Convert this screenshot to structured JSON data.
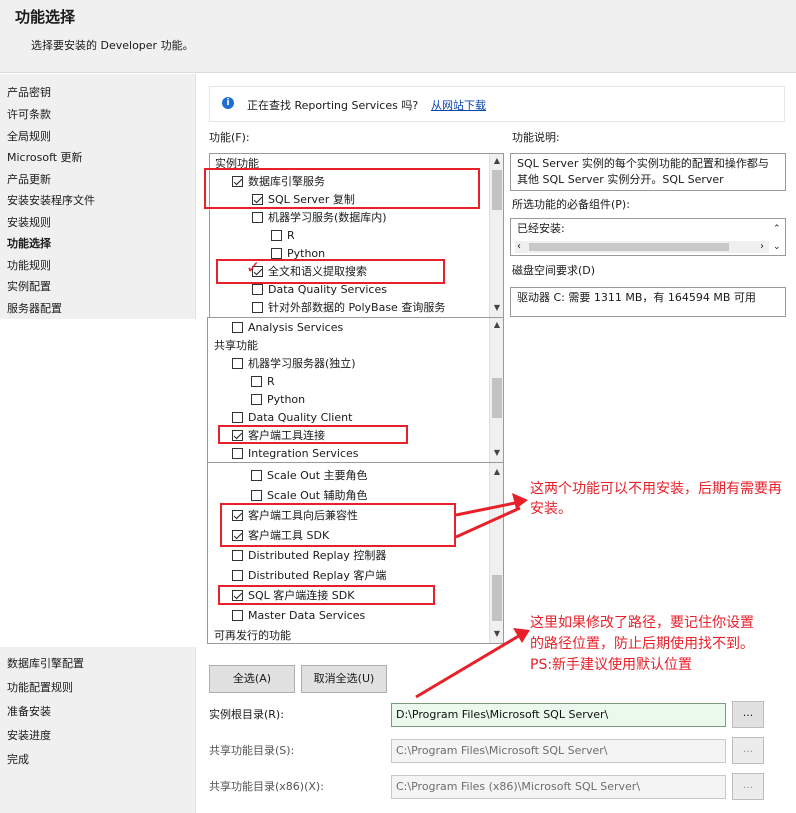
{
  "header": {
    "title": "功能选择",
    "subtitle": "选择要安装的 Developer 功能。"
  },
  "nav_top": [
    {
      "label": "产品密钥",
      "selected": false
    },
    {
      "label": "许可条款",
      "selected": false
    },
    {
      "label": "全局规则",
      "selected": false
    },
    {
      "label": "Microsoft 更新",
      "selected": false
    },
    {
      "label": "产品更新",
      "selected": false
    },
    {
      "label": "安装安装程序文件",
      "selected": false
    },
    {
      "label": "安装规则",
      "selected": false
    },
    {
      "label": "功能选择",
      "selected": true
    },
    {
      "label": "功能规则",
      "selected": false
    },
    {
      "label": "实例配置",
      "selected": false
    },
    {
      "label": "服务器配置",
      "selected": false
    }
  ],
  "nav_bottom": [
    {
      "label": "数据库引擎配置"
    },
    {
      "label": "功能配置规则"
    },
    {
      "label": "准备安装"
    },
    {
      "label": "安装进度"
    },
    {
      "label": "完成"
    }
  ],
  "info": {
    "text": "正在查找 Reporting Services 吗?",
    "link": "从网站下载"
  },
  "features_label": "功能(F):",
  "description_label": "功能说明:",
  "description_text": "SQL Server 实例的每个实例功能的配置和操作都与其他 SQL Server 实例分开。SQL Server",
  "prereq_label": "所选功能的必备组件(P):",
  "prereq_text": "已经安装:",
  "disk_label": "磁盘空间要求(D)",
  "disk_text": "驱动器 C: 需要 1311 MB，有 164594 MB 可用",
  "tree1": [
    {
      "label": "实例功能",
      "type": "group",
      "indent": 0
    },
    {
      "label": "数据库引擎服务",
      "checked": true,
      "indent": 1
    },
    {
      "label": "SQL Server 复制",
      "checked": true,
      "indent": 2
    },
    {
      "label": "机器学习服务(数据库内)",
      "checked": false,
      "indent": 2
    },
    {
      "label": "R",
      "checked": false,
      "indent": 3
    },
    {
      "label": "Python",
      "checked": false,
      "indent": 3
    },
    {
      "label": "全文和语义提取搜索",
      "checked": true,
      "indent": 2
    },
    {
      "label": "Data Quality Services",
      "checked": false,
      "indent": 2
    },
    {
      "label": "针对外部数据的 PolyBase 查询服务",
      "checked": false,
      "indent": 2
    }
  ],
  "tree2": [
    {
      "label": "Analysis Services",
      "checked": false,
      "indent": 1
    },
    {
      "label": "共享功能",
      "type": "group",
      "indent": 0
    },
    {
      "label": "机器学习服务器(独立)",
      "checked": false,
      "indent": 1
    },
    {
      "label": "R",
      "checked": false,
      "indent": 2
    },
    {
      "label": "Python",
      "checked": false,
      "indent": 2
    },
    {
      "label": "Data Quality Client",
      "checked": false,
      "indent": 1
    },
    {
      "label": "客户端工具连接",
      "checked": true,
      "indent": 1
    },
    {
      "label": "Integration Services",
      "checked": false,
      "indent": 1
    }
  ],
  "tree3": [
    {
      "label": "Scale Out 主要角色",
      "checked": false,
      "indent": 2
    },
    {
      "label": "Scale Out 辅助角色",
      "checked": false,
      "indent": 2
    },
    {
      "label": "客户端工具向后兼容性",
      "checked": true,
      "indent": 1
    },
    {
      "label": "客户端工具 SDK",
      "checked": true,
      "indent": 1
    },
    {
      "label": "Distributed Replay 控制器",
      "checked": false,
      "indent": 1
    },
    {
      "label": "Distributed Replay 客户端",
      "checked": false,
      "indent": 1
    },
    {
      "label": "SQL 客户端连接 SDK",
      "checked": true,
      "indent": 1
    },
    {
      "label": "Master Data Services",
      "checked": false,
      "indent": 1
    },
    {
      "label": "可再发行的功能",
      "type": "group",
      "indent": 0
    }
  ],
  "buttons": {
    "select_all": "全选(A)",
    "deselect_all": "取消全选(U)",
    "browse": "..."
  },
  "paths": [
    {
      "label": "实例根目录(R):",
      "value": "D:\\Program Files\\Microsoft SQL Server\\",
      "enabled": true
    },
    {
      "label": "共享功能目录(S):",
      "value": "C:\\Program Files\\Microsoft SQL Server\\",
      "enabled": false
    },
    {
      "label": "共享功能目录(x86)(X):",
      "value": "C:\\Program Files (x86)\\Microsoft SQL Server\\",
      "enabled": false
    }
  ],
  "annotations": {
    "note1": "这两个功能可以不用安装，后期有需要再安装。",
    "note2_line1": "这里如果修改了路径，要记住你设置",
    "note2_line2": "的路径位置，防止后期使用找不到。",
    "note2_line3": "PS:新手建议使用默认位置"
  },
  "colors": {
    "accent_red": "#e8202a",
    "link_blue": "#0645ad",
    "info_blue": "#1e6fd0"
  }
}
